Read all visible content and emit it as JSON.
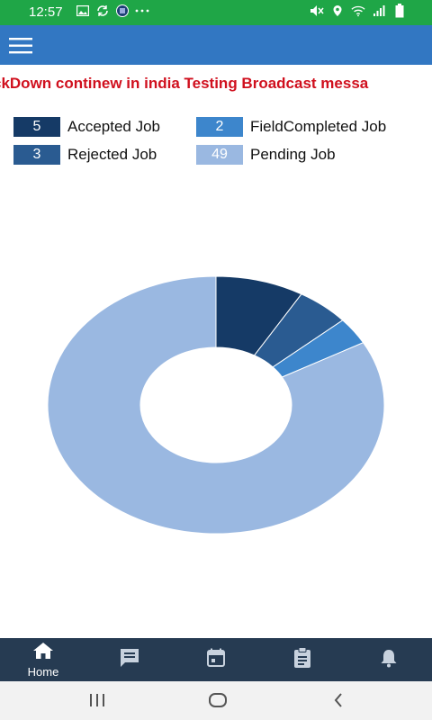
{
  "status_bar": {
    "time": "12:57",
    "left_icons": [
      "image-icon",
      "sync-icon",
      "app-icon",
      "more-dots-icon"
    ],
    "right_icons": [
      "mute-icon",
      "location-icon",
      "wifi-icon",
      "signal-icon",
      "battery-icon"
    ],
    "color": "#1fa647"
  },
  "app_bar": {
    "color": "#3277c2",
    "menu_icon": "hamburger-menu-icon"
  },
  "broadcast": {
    "text": "ckDown continew in india Testing Broadcast messa",
    "color": "#d0101e"
  },
  "legend": [
    {
      "count": "5",
      "label": "Accepted Job",
      "color": "#153a66"
    },
    {
      "count": "2",
      "label": "FieldCompleted Job",
      "color": "#3d86cc"
    },
    {
      "count": "3",
      "label": "Rejected Job",
      "color": "#2a5b91"
    },
    {
      "count": "49",
      "label": "Pending Job",
      "color": "#9ab8e1"
    }
  ],
  "chart_data": {
    "type": "pie",
    "donut": true,
    "title": "",
    "slices": [
      {
        "label": "Accepted Job",
        "value": 5,
        "color": "#153a66"
      },
      {
        "label": "Rejected Job",
        "value": 3,
        "color": "#2a5b91"
      },
      {
        "label": "FieldCompleted Job",
        "value": 2,
        "color": "#3d86cc"
      },
      {
        "label": "Pending Job",
        "value": 49,
        "color": "#9ab8e1"
      }
    ],
    "start_angle": "top",
    "direction": "clockwise"
  },
  "bottom_nav": {
    "color": "#263b52",
    "items": [
      {
        "icon": "home-icon",
        "label": "Home",
        "active": true
      },
      {
        "icon": "message-icon",
        "label": ""
      },
      {
        "icon": "calendar-icon",
        "label": ""
      },
      {
        "icon": "clipboard-icon",
        "label": ""
      },
      {
        "icon": "bell-icon",
        "label": ""
      }
    ]
  },
  "system_nav": {
    "buttons": [
      "recents-icon",
      "home-circle-icon",
      "back-icon"
    ]
  }
}
